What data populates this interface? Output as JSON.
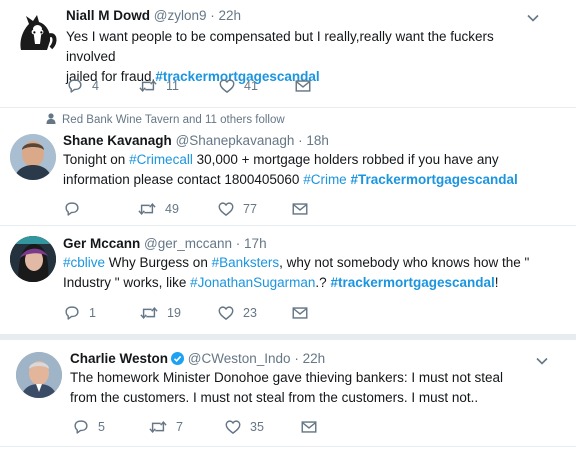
{
  "tweets": [
    {
      "name": "Niall M Dowd",
      "handle": "@zylon9",
      "time": "22h",
      "text_line1": "Yes I want people to be compensated but I really,really want the fuckers involved",
      "text_line2_plain": "jailed for fraud.",
      "text_line2_hashtag": "#trackermortgagescandal",
      "replies": "4",
      "retweets": "11",
      "likes": "41",
      "avatar_icon": "cartoon-skunk-avatar"
    },
    {
      "context": "Red Bank Wine Tavern and 11 others follow",
      "name": "Shane Kavanagh",
      "handle": "@Shanepkavanagh",
      "time": "18h",
      "l1_a": "Tonight on ",
      "l1_tag": "#Crimecall",
      "l1_b": " 30,000 + mortgage holders robbed if you have any",
      "l2_a": "information please contact 1800405060 ",
      "l2_tag1": "#Crime",
      "l2_sp": " ",
      "l2_tag2": "#Trackermortgagescandal",
      "replies": "",
      "retweets": "49",
      "likes": "77",
      "avatar_icon": "man-avatar"
    },
    {
      "name": "Ger Mccann",
      "handle": "@ger_mccann",
      "time": "17h",
      "l1_tag1": "#cblive",
      "l1_a": " Why Burgess on ",
      "l1_tag2": "#Banksters",
      "l1_b": ", why not somebody who knows how the \"",
      "l2_a": "Industry \" works, like ",
      "l2_tag1": "#JonathanSugarman",
      "l2_b": ".? ",
      "l2_tag2": "#trackermortgagescandal",
      "l2_c": "!",
      "replies": "1",
      "retweets": "19",
      "likes": "23",
      "avatar_icon": "person-avatar"
    },
    {
      "name": "Charlie Weston",
      "handle": "@CWeston_Indo",
      "time": "22h",
      "text_line1": "The homework Minister Donohoe gave thieving bankers: I must not steal",
      "text_line2": "from the customers. I must not steal from the customers. I must not..",
      "replies": "5",
      "retweets": "7",
      "likes": "35",
      "avatar_icon": "older-man-avatar"
    }
  ],
  "colors": {
    "accent": "#1b95e0",
    "muted": "#657786",
    "text": "#14171a",
    "divider": "#e6ecf0"
  }
}
